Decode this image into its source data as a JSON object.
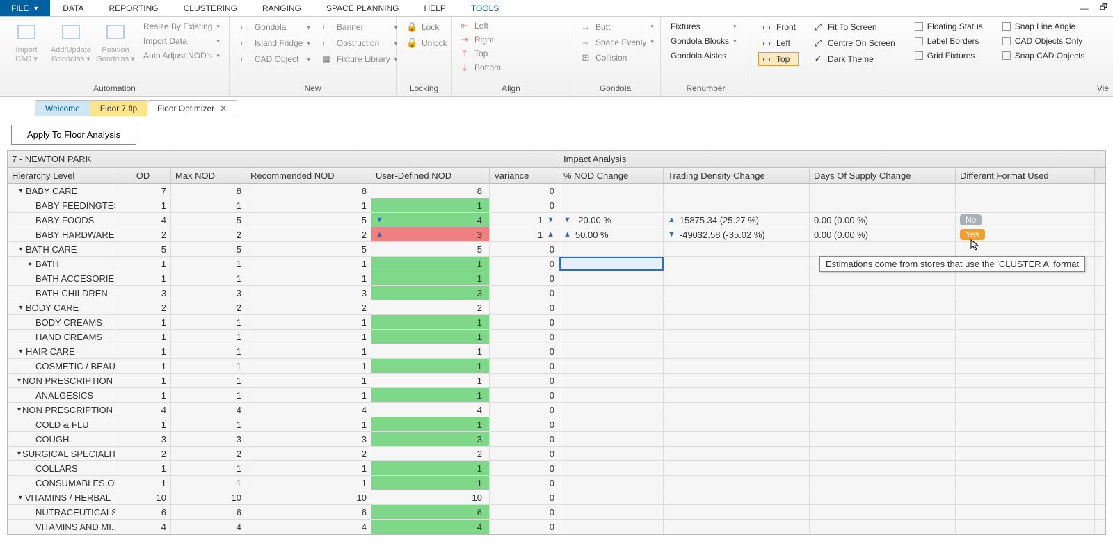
{
  "menu": {
    "file": "FILE",
    "items": [
      "DATA",
      "REPORTING",
      "CLUSTERING",
      "RANGING",
      "SPACE PLANNING",
      "HELP",
      "TOOLS"
    ],
    "active": 6
  },
  "ribbon": {
    "automation": {
      "label": "Automation",
      "big": [
        {
          "l1": "Import",
          "l2": "CAD"
        },
        {
          "l1": "Add/Update",
          "l2": "Gondolas"
        },
        {
          "l1": "Position",
          "l2": "Gondolas"
        }
      ],
      "opts": [
        "Resize By Existing",
        "Import Data",
        "Auto Adjust NOD's"
      ]
    },
    "new": {
      "label": "New",
      "col1": [
        "Gondola",
        "Island Fridge",
        "CAD Object"
      ],
      "col2": [
        "Banner",
        "Obstruction",
        "Fixture Library"
      ]
    },
    "locking": {
      "label": "Locking",
      "items": [
        "Lock",
        "Unlock"
      ]
    },
    "align": {
      "label": "Align",
      "items": [
        "Left",
        "Right",
        "Top",
        "Bottom"
      ]
    },
    "gondola": {
      "label": "Gondola",
      "items": [
        "Butt",
        "Space Evenly",
        "Collision"
      ]
    },
    "renumber": {
      "label": "Renumber",
      "items": [
        "Fixtures",
        "Gondola Blocks",
        "Gondola Aisles"
      ]
    },
    "side": {
      "items": [
        "Front",
        "Left",
        "Top"
      ]
    },
    "view1": {
      "items": [
        "Fit To Screen",
        "Centre On Screen",
        "Dark Theme"
      ]
    },
    "view2a": [
      "Floating Status",
      "Label Borders",
      "Grid Fixtures"
    ],
    "view2b": [
      "Snap Line Angle",
      "CAD Objects Only",
      "Snap CAD Objects"
    ],
    "vie": "Vie"
  },
  "tabs": {
    "welcome": "Welcome",
    "file": "Floor 7.flp",
    "active": "Floor Optimizer"
  },
  "toolbar": {
    "apply": "Apply To Floor Analysis"
  },
  "store": "7 - NEWTON PARK",
  "impact_label": "Impact Analysis",
  "cols": {
    "hier": "Hierarchy Level",
    "od": "OD",
    "max": "Max NOD",
    "rec": "Recommended NOD",
    "ud": "User-Defined NOD",
    "var": "Variance",
    "pct": "% NOD Change",
    "tdc": "Trading Density Change",
    "dos": "Days Of Supply Change",
    "dfmt": "Different Format Used"
  },
  "rows": [
    {
      "lvl": 0,
      "exp": "▾",
      "name": "BABY CARE",
      "od": "7",
      "max": "8",
      "rec": "8",
      "ud": "8",
      "udc": "",
      "var": "0"
    },
    {
      "lvl": 1,
      "name": "BABY FEEDINGTES...",
      "od": "1",
      "max": "1",
      "rec": "1",
      "ud": "1",
      "udc": "green",
      "var": "0"
    },
    {
      "lvl": 1,
      "name": "BABY FOODS",
      "od": "4",
      "max": "5",
      "rec": "5",
      "ud": "4",
      "udc": "green",
      "tri": "down",
      "vartri": "down",
      "var": "-1",
      "pcttri": "down",
      "pct": "-20.00 %",
      "tdctri": "up",
      "tdc": "15875.34 (25.27 %)",
      "dos": "0.00 (0.00 %)",
      "badge": "No"
    },
    {
      "lvl": 1,
      "name": "BABY HARDWARE",
      "od": "2",
      "max": "2",
      "rec": "2",
      "ud": "3",
      "udc": "red",
      "tri": "up",
      "vartri": "up",
      "var": "1",
      "pcttri": "up",
      "pct": "50.00 %",
      "tdctri": "down",
      "tdc": "-49032.58 (-35.02 %)",
      "dos": "0.00 (0.00 %)",
      "badge": "Yes"
    },
    {
      "lvl": 0,
      "exp": "▾",
      "name": "BATH CARE",
      "od": "5",
      "max": "5",
      "rec": "5",
      "ud": "5",
      "udc": "",
      "var": "0"
    },
    {
      "lvl": 1,
      "sub": "▸",
      "name": "BATH",
      "od": "1",
      "max": "1",
      "rec": "1",
      "ud": "1",
      "udc": "green",
      "var": "0",
      "selected": true
    },
    {
      "lvl": 1,
      "name": "BATH ACCESORIES",
      "od": "1",
      "max": "1",
      "rec": "1",
      "ud": "1",
      "udc": "green",
      "var": "0"
    },
    {
      "lvl": 1,
      "name": "BATH CHILDREN",
      "od": "3",
      "max": "3",
      "rec": "3",
      "ud": "3",
      "udc": "green",
      "var": "0"
    },
    {
      "lvl": 0,
      "exp": "▾",
      "name": "BODY CARE",
      "od": "2",
      "max": "2",
      "rec": "2",
      "ud": "2",
      "udc": "",
      "var": "0"
    },
    {
      "lvl": 1,
      "name": "BODY CREAMS",
      "od": "1",
      "max": "1",
      "rec": "1",
      "ud": "1",
      "udc": "green",
      "var": "0"
    },
    {
      "lvl": 1,
      "name": "HAND CREAMS",
      "od": "1",
      "max": "1",
      "rec": "1",
      "ud": "1",
      "udc": "green",
      "var": "0"
    },
    {
      "lvl": 0,
      "exp": "▾",
      "name": "HAIR CARE",
      "od": "1",
      "max": "1",
      "rec": "1",
      "ud": "1",
      "udc": "",
      "var": "0"
    },
    {
      "lvl": 1,
      "name": "COSMETIC / BEAU...",
      "od": "1",
      "max": "1",
      "rec": "1",
      "ud": "1",
      "udc": "green",
      "var": "0"
    },
    {
      "lvl": 0,
      "exp": "▾",
      "name": "NON PRESCRIPTION",
      "od": "1",
      "max": "1",
      "rec": "1",
      "ud": "1",
      "udc": "",
      "var": "0"
    },
    {
      "lvl": 1,
      "name": "ANALGESICS",
      "od": "1",
      "max": "1",
      "rec": "1",
      "ud": "1",
      "udc": "green",
      "var": "0"
    },
    {
      "lvl": 0,
      "exp": "▾",
      "name": "NON PRESCRIPTION R",
      "od": "4",
      "max": "4",
      "rec": "4",
      "ud": "4",
      "udc": "",
      "var": "0"
    },
    {
      "lvl": 1,
      "name": "COLD & FLU",
      "od": "1",
      "max": "1",
      "rec": "1",
      "ud": "1",
      "udc": "green",
      "var": "0"
    },
    {
      "lvl": 1,
      "name": "COUGH",
      "od": "3",
      "max": "3",
      "rec": "3",
      "ud": "3",
      "udc": "green",
      "var": "0"
    },
    {
      "lvl": 0,
      "exp": "▾",
      "name": "SURGICAL SPECIALIT",
      "od": "2",
      "max": "2",
      "rec": "2",
      "ud": "2",
      "udc": "",
      "var": "0"
    },
    {
      "lvl": 1,
      "name": "COLLARS",
      "od": "1",
      "max": "1",
      "rec": "1",
      "ud": "1",
      "udc": "green",
      "var": "0"
    },
    {
      "lvl": 1,
      "name": "CONSUMABLES OT...",
      "od": "1",
      "max": "1",
      "rec": "1",
      "ud": "1",
      "udc": "green",
      "var": "0"
    },
    {
      "lvl": 0,
      "exp": "▾",
      "name": "VITAMINS / HERBAL",
      "od": "10",
      "max": "10",
      "rec": "10",
      "ud": "10",
      "udc": "",
      "var": "0"
    },
    {
      "lvl": 1,
      "name": "NUTRACEUTICALS",
      "od": "6",
      "max": "6",
      "rec": "6",
      "ud": "6",
      "udc": "green",
      "var": "0"
    },
    {
      "lvl": 1,
      "name": "VITAMINS AND MI...",
      "od": "4",
      "max": "4",
      "rec": "4",
      "ud": "4",
      "udc": "green",
      "var": "0"
    }
  ],
  "tooltip": "Estimations come from stores that use the 'CLUSTER A' format"
}
